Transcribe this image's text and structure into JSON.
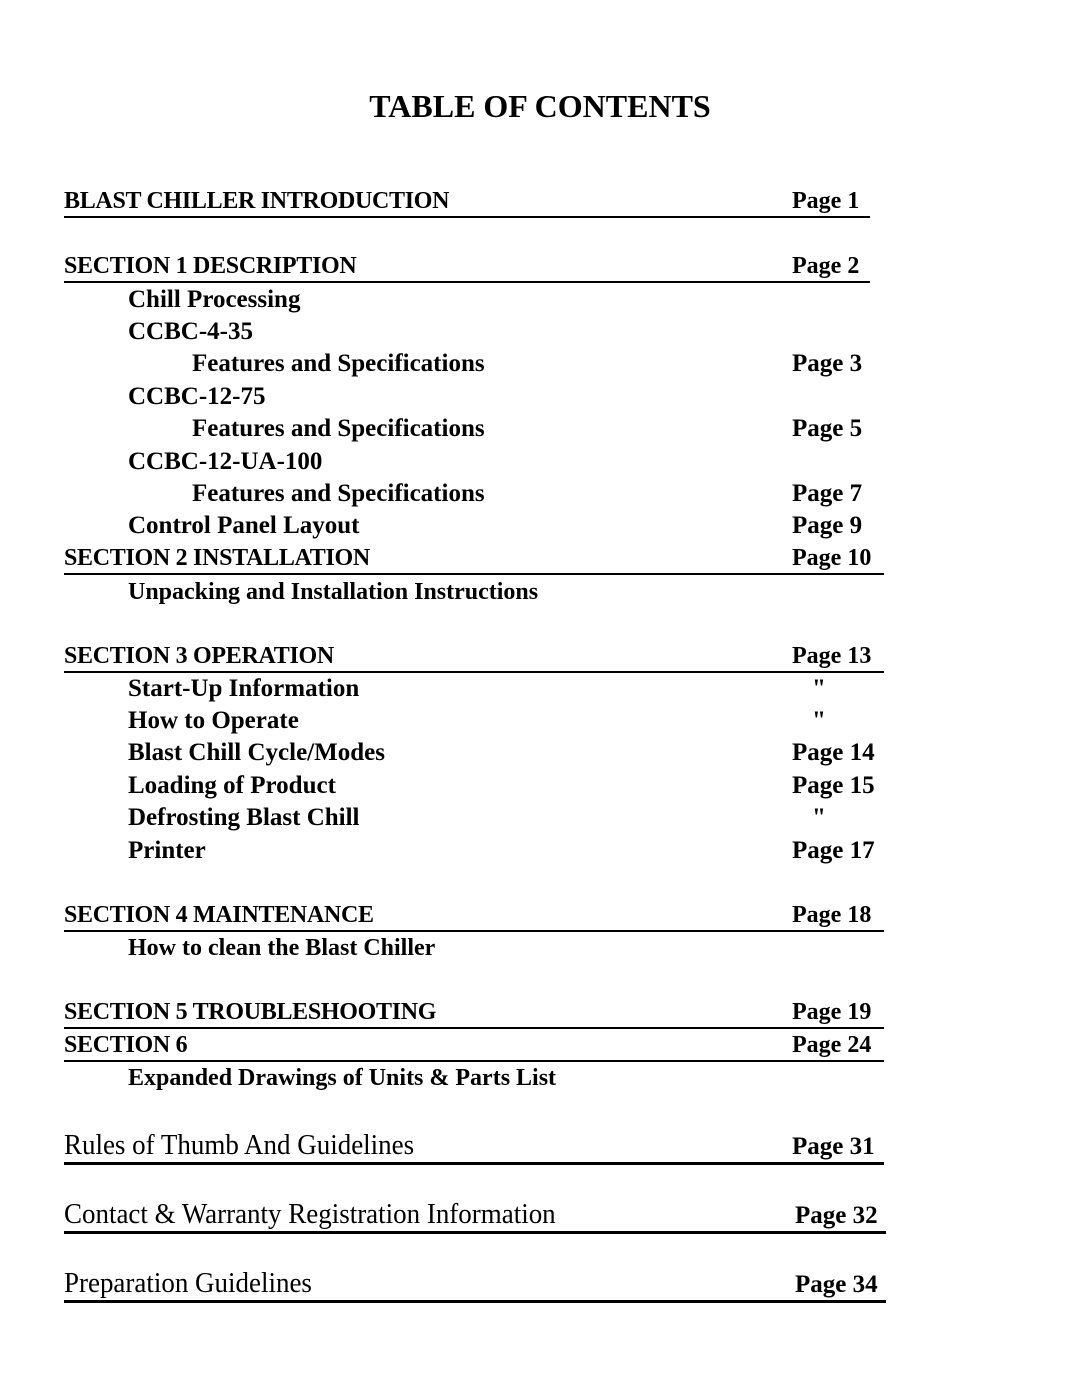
{
  "title": "TABLE OF CONTENTS",
  "entries": [
    {
      "label": "BLAST CHILLER INTRODUCTION",
      "page": "Page 1"
    },
    {
      "label": "SECTION 1  DESCRIPTION",
      "page": "Page 2"
    },
    {
      "label": "Chill Processing",
      "page": ""
    },
    {
      "label": "CCBC-4-35",
      "page": ""
    },
    {
      "label": "Features and Specifications",
      "page": "Page 3"
    },
    {
      "label": "CCBC-12-75",
      "page": ""
    },
    {
      "label": "Features and Specifications",
      "page": "Page 5"
    },
    {
      "label": "CCBC-12-UA-100",
      "page": ""
    },
    {
      "label": "Features and Specifications",
      "page": "Page 7"
    },
    {
      "label": "Control Panel Layout",
      "page": "Page 9"
    },
    {
      "label": "SECTION 2  INSTALLATION",
      "page": "Page 10"
    },
    {
      "label": "Unpacking and Installation Instructions",
      "page": ""
    },
    {
      "label": "SECTION 3  OPERATION",
      "page": "Page 13"
    },
    {
      "label": "Start-Up Information",
      "page": "\""
    },
    {
      "label": "How to Operate",
      "page": "\""
    },
    {
      "label": "Blast Chill Cycle/Modes",
      "page": "Page 14"
    },
    {
      "label": "Loading of Product",
      "page": "Page 15"
    },
    {
      "label": "Defrosting Blast Chill",
      "page": "\""
    },
    {
      "label": "Printer",
      "page": "Page 17"
    },
    {
      "label": "SECTION 4  MAINTENANCE",
      "page": "Page 18"
    },
    {
      "label": "How to clean the Blast Chiller",
      "page": ""
    },
    {
      "label": "SECTION 5  TROUBLESHOOTING",
      "page": "Page 19"
    },
    {
      "label": "SECTION 6",
      "page": "Page 24"
    },
    {
      "label": "Expanded Drawings of Units & Parts List",
      "page": ""
    },
    {
      "label": "Rules of Thumb And Guidelines",
      "page": "Page 31"
    },
    {
      "label": "Contact & Warranty  Registration Information",
      "page": "Page 32"
    },
    {
      "label": "Preparation Guidelines",
      "page": "Page 34"
    }
  ]
}
